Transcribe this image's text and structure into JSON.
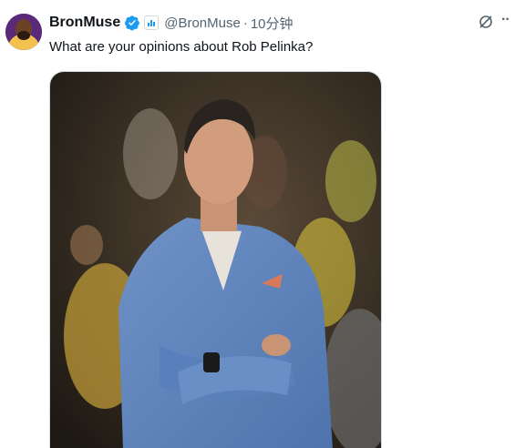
{
  "tweet": {
    "display_name": "BronMuse",
    "handle": "@BronMuse",
    "separator": "·",
    "time": "10分钟",
    "text": "What are your opinions about Rob Pelinka?"
  },
  "icons": {
    "verified": "verified-badge-icon",
    "affiliate": "affiliate-badge-icon",
    "grok": "grok-icon",
    "more": "more-icon"
  },
  "colors": {
    "verified_blue": "#1d9bf0",
    "secondary_text": "#536471",
    "primary_text": "#0f1419"
  }
}
